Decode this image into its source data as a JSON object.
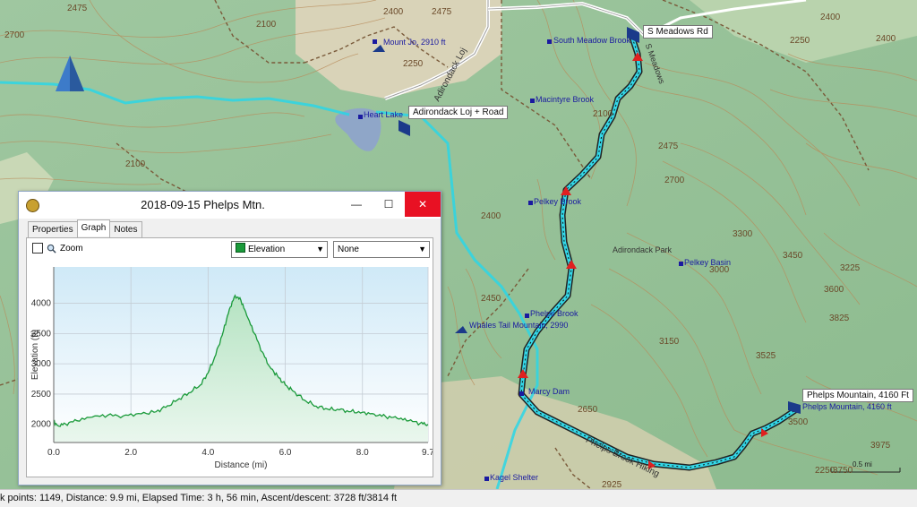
{
  "map": {
    "waypoints": [
      {
        "name": "S Meadows Rd",
        "callout": true
      },
      {
        "name": "Adirondack Loj + Road",
        "callout": true
      },
      {
        "name": "Phelps Mountain, 4160 Ft",
        "callout": true
      },
      {
        "name": "Mount Jo, 2910 ft"
      },
      {
        "name": "South Meadow Brook"
      },
      {
        "name": "Heart Lake"
      },
      {
        "name": "Macintyre Brook"
      },
      {
        "name": "Pelkey Brook"
      },
      {
        "name": "Pelkey Basin"
      },
      {
        "name": "Adirondack Park"
      },
      {
        "name": "Phelps Brook"
      },
      {
        "name": "Whales Tail Mountain, 2990"
      },
      {
        "name": "Marcy Dam"
      },
      {
        "name": "Phelps Mountain, 4160 ft"
      },
      {
        "name": "Kagel Shelter"
      }
    ],
    "road_labels": [
      "Adirondack Loj",
      "S Meadows",
      "Phelps Brook Hiking"
    ],
    "contour_labels": [
      "2475",
      "2400",
      "2475",
      "2100",
      "2250",
      "2700",
      "2100",
      "2100",
      "2400",
      "2400",
      "2250",
      "2475",
      "2700",
      "3300",
      "3450",
      "3225",
      "3000",
      "3600",
      "3825",
      "3150",
      "3525",
      "2650",
      "3975",
      "3500",
      "3750",
      "2925",
      "2400",
      "2450",
      "2250"
    ],
    "scale_label": "0.5 mi"
  },
  "window": {
    "title": "2018-09-15 Phelps Mtn.",
    "controls": {
      "minimize": "—",
      "maximize": "☐",
      "close": "✕"
    },
    "tabs": [
      "Properties",
      "Graph",
      "Notes"
    ],
    "active_tab": "Graph",
    "zoom_label": "Zoom",
    "zoom_checked": false,
    "series_select": "Elevation",
    "series_color": "#1a9a3a",
    "second_select": "None"
  },
  "chart_data": {
    "type": "area",
    "xlabel": "Distance  (mi)",
    "ylabel": "Elevation (ft)",
    "xlim": [
      0,
      9.7
    ],
    "ylim": [
      1700,
      4600
    ],
    "x_ticks": [
      "0.0",
      "2.0",
      "4.0",
      "6.0",
      "8.0",
      "9.7"
    ],
    "x_tick_values": [
      0,
      2,
      4,
      6,
      8,
      9.7
    ],
    "y_ticks": [
      "2000",
      "2500",
      "3000",
      "3500",
      "4000"
    ],
    "y_tick_values": [
      2000,
      2500,
      3000,
      3500,
      4000
    ],
    "grid": true,
    "series": [
      {
        "color": "#1a9a3a",
        "x": [
          0.0,
          0.1,
          0.3,
          0.6,
          1.0,
          1.4,
          1.8,
          2.2,
          2.6,
          2.9,
          3.2,
          3.5,
          3.8,
          4.0,
          4.2,
          4.4,
          4.55,
          4.7,
          4.85,
          5.0,
          5.2,
          5.4,
          5.6,
          5.8,
          6.0,
          6.2,
          6.5,
          6.8,
          7.1,
          7.4,
          7.7,
          8.0,
          8.3,
          8.6,
          8.9,
          9.2,
          9.5,
          9.7
        ],
        "y": [
          2050,
          1980,
          2010,
          2060,
          2120,
          2150,
          2140,
          2180,
          2200,
          2280,
          2400,
          2520,
          2650,
          2850,
          3150,
          3550,
          3900,
          4130,
          4050,
          3800,
          3500,
          3200,
          2950,
          2800,
          2650,
          2550,
          2400,
          2300,
          2250,
          2240,
          2210,
          2200,
          2170,
          2130,
          2100,
          2060,
          2020,
          2000
        ]
      }
    ]
  },
  "status": {
    "text": "k points: 1149, Distance: 9.9 mi, Elapsed Time: 3 h, 56 min, Ascent/descent: 3728 ft/3814 ft"
  }
}
